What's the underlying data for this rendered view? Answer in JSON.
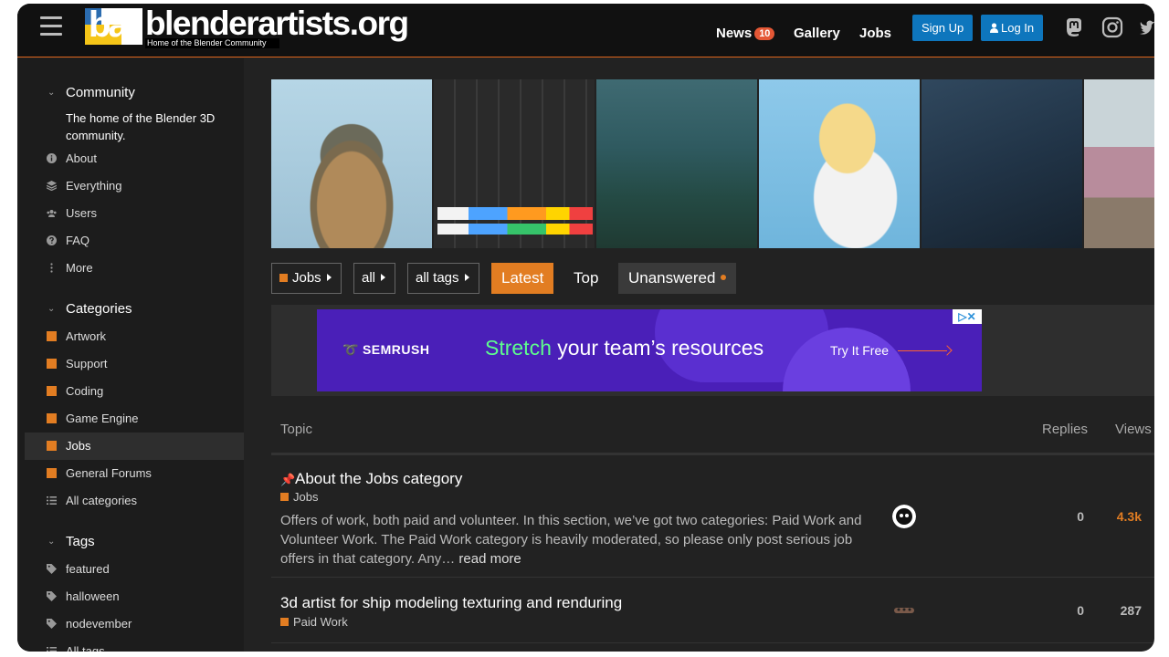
{
  "header": {
    "logo_name": "blenderartists.org",
    "logo_mark": "ba",
    "logo_tagline": "Home of the Blender Community",
    "nav": [
      {
        "label": "News",
        "badge": "10"
      },
      {
        "label": "Gallery"
      },
      {
        "label": "Jobs"
      }
    ],
    "signup_label": "Sign Up",
    "login_label": "Log In",
    "social_icons": [
      "mastodon-icon",
      "instagram-icon",
      "twitter-icon"
    ]
  },
  "sidebar": {
    "community": {
      "heading": "Community",
      "description": "The home of the Blender 3D community.",
      "items": [
        {
          "label": "About",
          "icon": "info-icon"
        },
        {
          "label": "Everything",
          "icon": "layers-icon"
        },
        {
          "label": "Users",
          "icon": "users-icon"
        },
        {
          "label": "FAQ",
          "icon": "question-icon"
        },
        {
          "label": "More",
          "icon": "ellipsis-vertical-icon"
        }
      ]
    },
    "categories": {
      "heading": "Categories",
      "items": [
        {
          "label": "Artwork"
        },
        {
          "label": "Support"
        },
        {
          "label": "Coding"
        },
        {
          "label": "Game Engine"
        },
        {
          "label": "Jobs",
          "active": true
        },
        {
          "label": "General Forums"
        },
        {
          "label": "All categories",
          "icon": "list-icon"
        }
      ]
    },
    "tags": {
      "heading": "Tags",
      "items": [
        {
          "label": "featured"
        },
        {
          "label": "halloween"
        },
        {
          "label": "nodevember"
        },
        {
          "label": "All tags"
        }
      ]
    }
  },
  "filters": {
    "category": "Jobs",
    "subcategory": "all",
    "tags": "all tags"
  },
  "tabs": {
    "latest": "Latest",
    "top": "Top",
    "unanswered": "Unanswered"
  },
  "ad": {
    "brand": "SEMRUSH",
    "headline_accent": "Stretch",
    "headline_rest": " your team’s resources",
    "cta": "Try It Free"
  },
  "topic_list": {
    "columns": {
      "topic": "Topic",
      "replies": "Replies",
      "views": "Views"
    },
    "rows": [
      {
        "title": "About the Jobs category",
        "pinned": true,
        "category": "Jobs",
        "excerpt": "Offers of work, both paid and volunteer. In this section, we’ve got two categories: Paid Work and Volunteer Work. The Paid Work category is heavily moderated, so please only post serious job offers in that category. Any…",
        "read_more": "read more",
        "replies": "0",
        "views": "4.3k"
      },
      {
        "title": "3d artist for ship modeling texturing and renduring",
        "pinned": false,
        "category": "Paid Work",
        "replies": "0",
        "views": "287"
      }
    ]
  },
  "colors": {
    "accent": "#e27d22",
    "header_bg": "#111111",
    "page_bg": "#222222",
    "button_blue": "#0e76bd",
    "ad_purple": "#4a1fb8"
  }
}
